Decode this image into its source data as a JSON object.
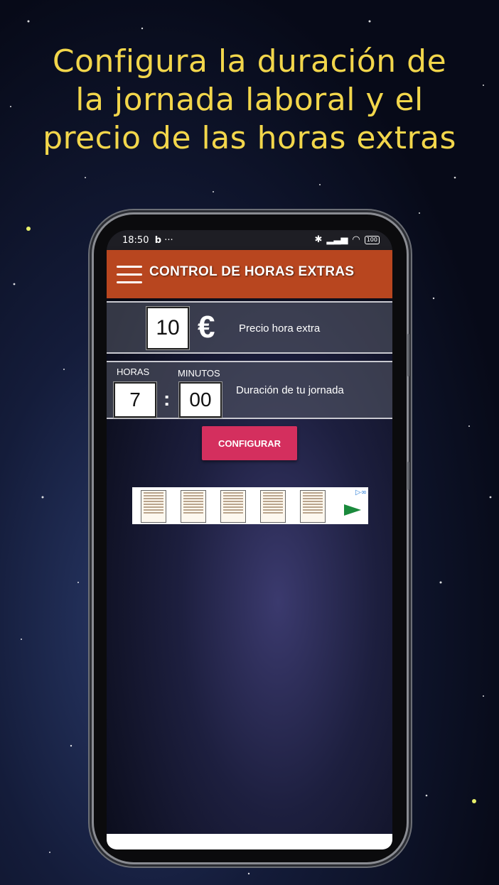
{
  "headline": {
    "lines": [
      "Configura la duración de",
      "la jornada laboral y el",
      "precio de las horas extras"
    ]
  },
  "status_bar": {
    "time": "18:50",
    "app_icon": "b",
    "dots": "···",
    "battery": "100"
  },
  "app_bar": {
    "title": "CONTROL DE HORAS EXTRAS",
    "menu_icon": "hamburger-icon"
  },
  "price": {
    "value": "10",
    "currency": "€",
    "label": "Precio hora extra"
  },
  "duration": {
    "hours_label": "HORAS",
    "hours_value": "7",
    "separator": ":",
    "minutes_label": "MINUTOS",
    "minutes_value": "00",
    "label": "Duración de tu jornada"
  },
  "actions": {
    "configure_label": "CONFIGURAR"
  },
  "colors": {
    "headline": "#f2d64b",
    "app_bar": "#b8461f",
    "button": "#d42f5e"
  }
}
